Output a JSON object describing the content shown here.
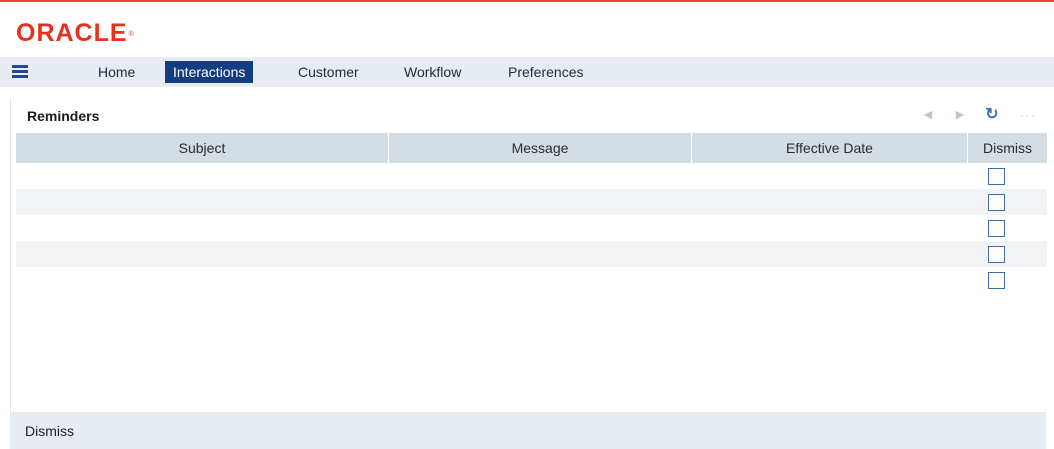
{
  "branding": {
    "logo_text": "ORACLE",
    "logo_mark": "®",
    "accent": "#e8301c"
  },
  "nav": {
    "menu_icon": "hamburger-menu-icon",
    "items": [
      {
        "label": "Home",
        "active": false
      },
      {
        "label": "Interactions",
        "active": true
      },
      {
        "label": "Customer",
        "active": false
      },
      {
        "label": "Workflow",
        "active": false
      },
      {
        "label": "Preferences",
        "active": false
      }
    ],
    "active_color": "#123d80"
  },
  "reminders": {
    "title": "Reminders",
    "toolbar": {
      "prev_icon": "previous-icon",
      "next_icon": "next-icon",
      "refresh_icon": "refresh-icon",
      "more_icon": "more-options-icon"
    },
    "columns": [
      "Subject",
      "Message",
      "Effective Date",
      "Dismiss"
    ],
    "rows": [
      {
        "subject": "",
        "message": "",
        "effective_date": "",
        "dismiss": false
      },
      {
        "subject": "",
        "message": "",
        "effective_date": "",
        "dismiss": false
      },
      {
        "subject": "",
        "message": "",
        "effective_date": "",
        "dismiss": false
      },
      {
        "subject": "",
        "message": "",
        "effective_date": "",
        "dismiss": false
      },
      {
        "subject": "",
        "message": "",
        "effective_date": "",
        "dismiss": false
      }
    ],
    "footer_action": "Dismiss"
  }
}
